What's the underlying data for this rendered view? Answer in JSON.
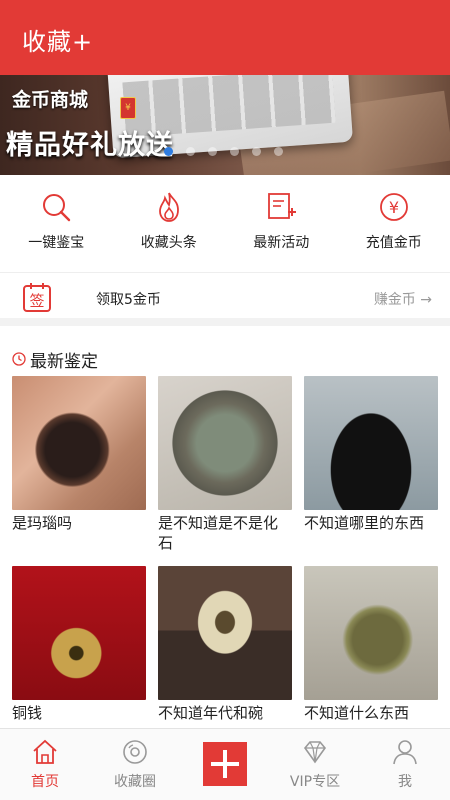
{
  "header": {
    "title": "收藏+"
  },
  "banner": {
    "small_text": "金币商城",
    "big_text": "精品好礼放送",
    "badge": "¥",
    "dots_count": 6,
    "active_dot": 0
  },
  "quick_actions": [
    {
      "label": "一键鉴宝",
      "icon": "search-icon"
    },
    {
      "label": "收藏头条",
      "icon": "flame-icon"
    },
    {
      "label": "最新活动",
      "icon": "new-document-icon"
    },
    {
      "label": "充值金币",
      "icon": "yen-coin-icon"
    }
  ],
  "sign": {
    "icon_char": "签",
    "text": "领取5金币",
    "earn_label": "赚金币",
    "arrow": "→"
  },
  "section": {
    "title": "最新鉴定"
  },
  "items": [
    {
      "caption": "是玛瑙吗"
    },
    {
      "caption": "是不知道是不是化石"
    },
    {
      "caption": "不知道哪里的东西"
    },
    {
      "caption": "铜钱"
    },
    {
      "caption": "不知道年代和碗"
    },
    {
      "caption": "不知道什么东西"
    }
  ],
  "tabs": [
    {
      "label": "首页",
      "icon": "home-icon",
      "active": true
    },
    {
      "label": "收藏圈",
      "icon": "disc-icon",
      "active": false
    },
    {
      "label": "",
      "icon": "plus-icon",
      "active": false
    },
    {
      "label": "VIP专区",
      "icon": "diamond-icon",
      "active": false
    },
    {
      "label": "我",
      "icon": "user-icon",
      "active": false
    }
  ],
  "colors": {
    "accent": "#e23a36",
    "dot_active": "#2f7de1"
  }
}
